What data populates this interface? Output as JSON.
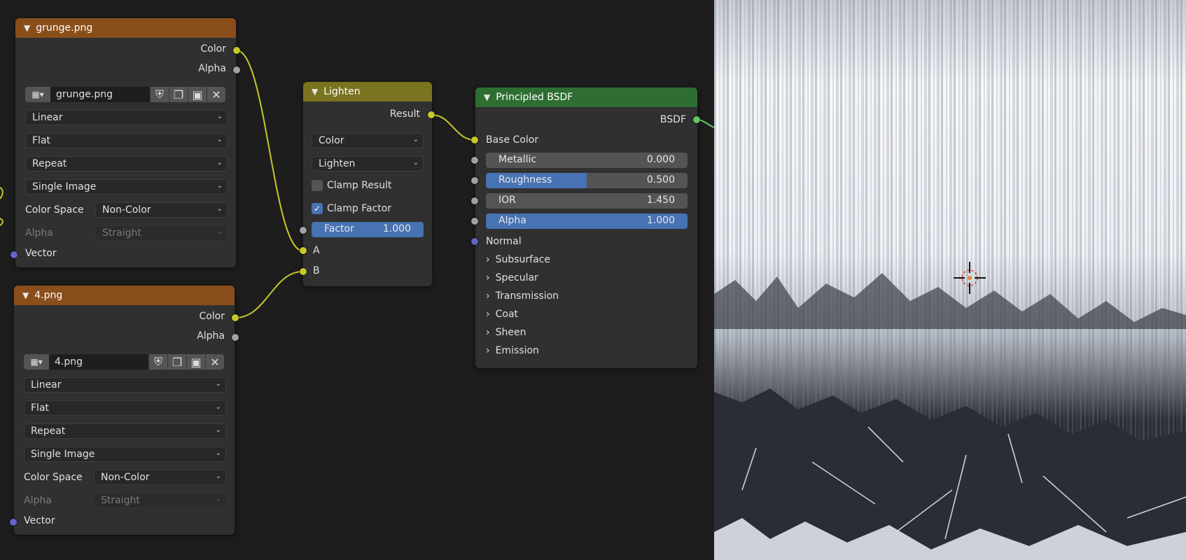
{
  "grunge_node": {
    "title": "grunge.png",
    "outputs": [
      "Color",
      "Alpha"
    ],
    "image_name": "grunge.png",
    "interpolation": "Linear",
    "projection": "Flat",
    "extension": "Repeat",
    "source": "Single Image",
    "color_space_label": "Color Space",
    "color_space": "Non-Color",
    "alpha_label": "Alpha",
    "alpha_mode": "Straight",
    "input_vector": "Vector"
  },
  "four_node": {
    "title": "4.png",
    "outputs": [
      "Color",
      "Alpha"
    ],
    "image_name": "4.png",
    "interpolation": "Linear",
    "projection": "Flat",
    "extension": "Repeat",
    "source": "Single Image",
    "color_space_label": "Color Space",
    "color_space": "Non-Color",
    "alpha_label": "Alpha",
    "alpha_mode": "Straight",
    "input_vector": "Vector"
  },
  "lighten_node": {
    "title": "Lighten",
    "output": "Result",
    "data_type": "Color",
    "blend_mode": "Lighten",
    "clamp_result_label": "Clamp Result",
    "clamp_result": false,
    "clamp_factor_label": "Clamp Factor",
    "clamp_factor": true,
    "factor_label": "Factor",
    "factor_value": "1.000",
    "input_a": "A",
    "input_b": "B"
  },
  "bsdf_node": {
    "title": "Principled BSDF",
    "output": "BSDF",
    "base_color": "Base Color",
    "fields": [
      {
        "label": "Metallic",
        "value": "0.000",
        "fill": 0.0
      },
      {
        "label": "Roughness",
        "value": "0.500",
        "fill": 0.5
      },
      {
        "label": "IOR",
        "value": "1.450",
        "fill": 0.0
      },
      {
        "label": "Alpha",
        "value": "1.000",
        "fill": 1.0
      }
    ],
    "normal": "Normal",
    "panels": [
      "Subsurface",
      "Specular",
      "Transmission",
      "Coat",
      "Sheen",
      "Emission"
    ]
  },
  "colors": {
    "image_header": "#8a4e1b",
    "mix_header": "#7a7320",
    "shader_header": "#2e6f31",
    "socket_yellow": "#c7c729",
    "socket_gray": "#a1a1a1",
    "socket_purple": "#6363c7",
    "socket_green": "#63c763",
    "field_active": "#4772b3"
  },
  "icons": [
    "chevron-down-icon",
    "image-icon",
    "shield-icon",
    "duplicate-icon",
    "folder-icon",
    "close-icon",
    "checkmark-icon",
    "chevron-right-icon",
    "crosshair-icon"
  ]
}
